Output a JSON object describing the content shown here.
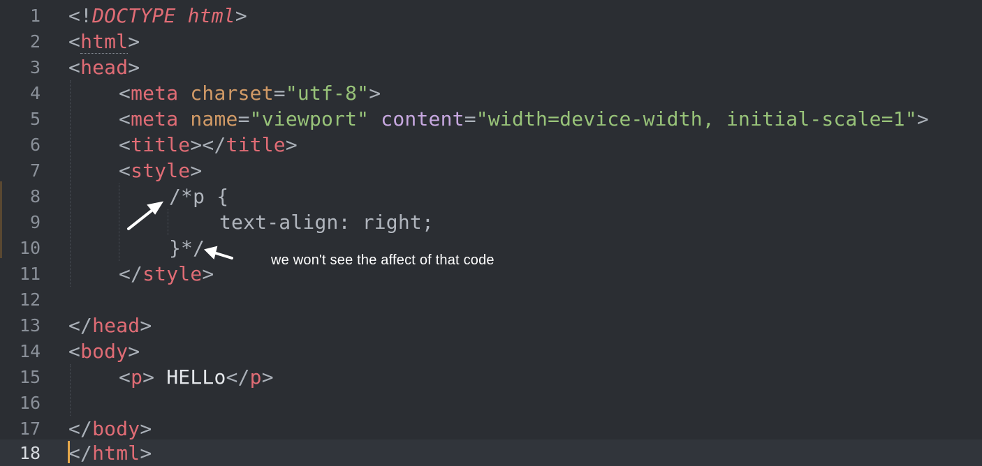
{
  "editor": {
    "line_numbers": [
      "1",
      "2",
      "3",
      "4",
      "5",
      "6",
      "7",
      "8",
      "9",
      "10",
      "11",
      "12",
      "13",
      "14",
      "15",
      "16",
      "17",
      "18"
    ],
    "active_line": "18",
    "lines": {
      "l1": {
        "open": "<!",
        "doctype": "DOCTYPE html",
        "close": ">"
      },
      "l2": {
        "open": "<",
        "tag": "html",
        "close": ">"
      },
      "l3": {
        "open": "<",
        "tag": "head",
        "close": ">"
      },
      "l4": {
        "open": "<",
        "tag": "meta",
        "attr": "charset",
        "eq": "=",
        "value": "\"utf-8\"",
        "close": ">"
      },
      "l5": {
        "open": "<",
        "tag": "meta",
        "attr1": "name",
        "eq1": "=",
        "value1": "\"viewport\"",
        "attr2": "content",
        "eq2": "=",
        "value2": "\"width=device-width, initial-scale=1\"",
        "close": ">"
      },
      "l6": {
        "open": "<",
        "tag": "title",
        "mid": "></",
        "tag2": "title",
        "close": ">"
      },
      "l7": {
        "open": "<",
        "tag": "style",
        "close": ">"
      },
      "l8": {
        "comment": "/*p {"
      },
      "l9": {
        "comment": "text-align: right;"
      },
      "l10": {
        "comment": "}*/"
      },
      "l11": {
        "open": "</",
        "tag": "style",
        "close": ">"
      },
      "l13": {
        "open": "</",
        "tag": "head",
        "close": ">"
      },
      "l14": {
        "open": "<",
        "tag": "body",
        "close": ">"
      },
      "l15": {
        "open": "<",
        "tag": "p",
        "mid": "> ",
        "text": "HELLo",
        "open2": "</",
        "tag2": "p",
        "close": ">"
      },
      "l17": {
        "open": "</",
        "tag": "body",
        "close": ">"
      },
      "l18": {
        "open": "</",
        "tag": "html",
        "close": ">"
      }
    }
  },
  "annotation": {
    "text": "we won't see the affect of that code"
  },
  "colors": {
    "background": "#2b2e33",
    "tag": "#e06c75",
    "attribute": "#d19a66",
    "string": "#98c379",
    "cursor": "#e5a84b"
  }
}
